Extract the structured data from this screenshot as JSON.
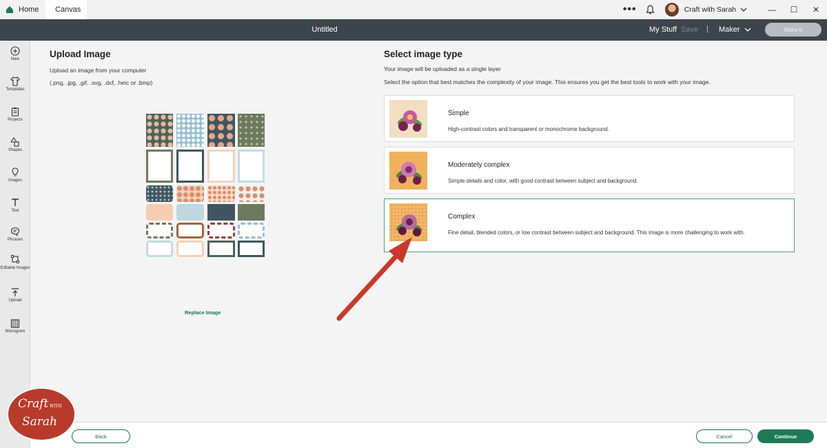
{
  "titlebar": {
    "tabs": [
      {
        "label": "Home",
        "icon": "home-icon"
      },
      {
        "label": "Canvas"
      }
    ],
    "more_label": "•••",
    "user_name": "Craft with Sarah",
    "window_controls": [
      "—",
      "☐",
      "✕"
    ]
  },
  "header": {
    "doc_title": "Untitled",
    "my_stuff": "My Stuff",
    "save": "Save",
    "separator": "|",
    "machine": "Maker",
    "make_it": "Make It"
  },
  "sidebar": {
    "items": [
      {
        "label": "New",
        "icon": "plus-circle-icon"
      },
      {
        "label": "Templates",
        "icon": "shirt-icon"
      },
      {
        "label": "Projects",
        "icon": "clipboard-icon"
      },
      {
        "label": "Shapes",
        "icon": "shapes-icon"
      },
      {
        "label": "Images",
        "icon": "lightbulb-icon"
      },
      {
        "label": "Text",
        "icon": "text-icon"
      },
      {
        "label": "Phrases",
        "icon": "speech-bubble-icon"
      },
      {
        "label": "Editable Images",
        "icon": "editable-image-icon"
      },
      {
        "label": "Upload",
        "icon": "upload-icon"
      },
      {
        "label": "Monogram",
        "icon": "monogram-icon"
      }
    ]
  },
  "upload": {
    "heading": "Upload Image",
    "instruction": "Upload an image from your computer",
    "formats": "(.png, .jpg, .gif, .svg, .dxf, .heic or .bmp)",
    "replace_label": "Replace Image"
  },
  "select": {
    "heading": "Select image type",
    "note": "Your image will be uploaded as a single layer",
    "instruction": "Select the option that best matches the complexity of your image. This ensures you get the best tools to work with your image.",
    "options": [
      {
        "title": "Simple",
        "description": "High-contrast colors and transparent or monochrome background.",
        "selected": false
      },
      {
        "title": "Moderately complex",
        "description": "Simple details and color, with good contrast between subject and background.",
        "selected": false
      },
      {
        "title": "Complex",
        "description": "Fine detail, blended colors, or low contrast between subject and background. This image is more challenging to work with.",
        "selected": true
      }
    ]
  },
  "footer": {
    "back": "Back",
    "cancel": "Cancel",
    "continue": "Continue"
  },
  "watermark": {
    "line1": "Craft",
    "line2": "WITH",
    "line3": "Sarah"
  },
  "colors": {
    "header_bg": "#3c444c",
    "accent": "#1d7a57",
    "selected_border": "#4f9b7a",
    "arrow": "#c9392a",
    "watermark": "#b83a2a"
  }
}
